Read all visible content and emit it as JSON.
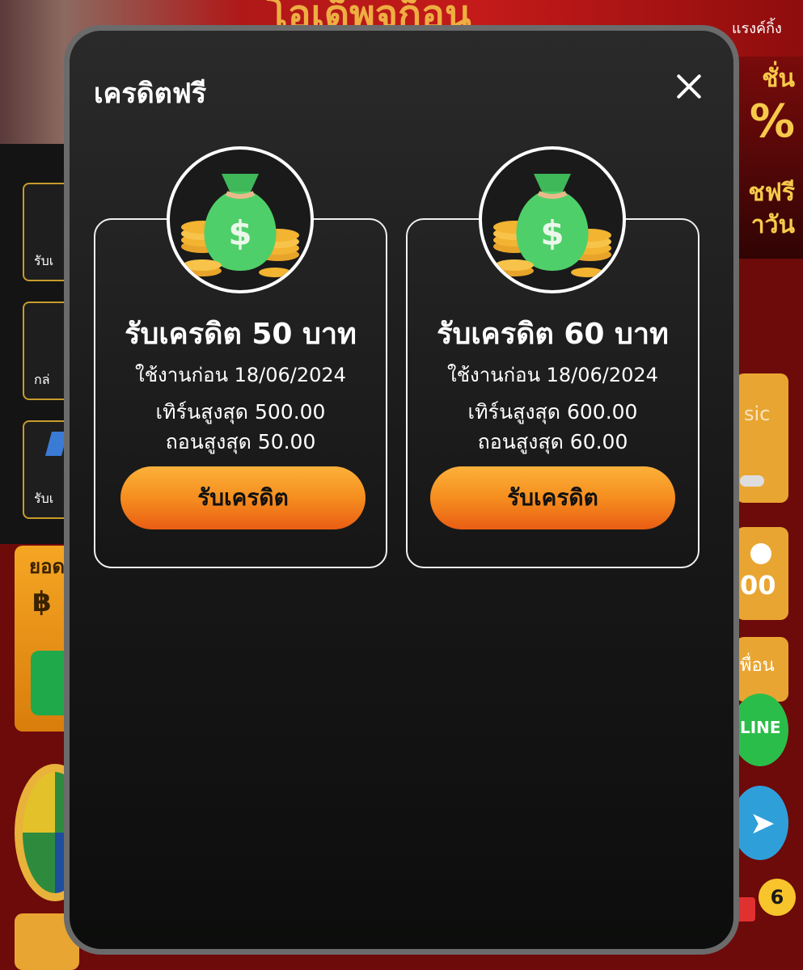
{
  "background": {
    "top_banner_text": "โอเด็พจก็อน",
    "top_right_label": "แรงค์กิ้ง",
    "promo_word_1": "ชั่น",
    "promo_percent": "%",
    "promo_word_2": "ชฟรี",
    "promo_word_3": "าวัน",
    "side_items": [
      "รับเ",
      "กล่",
      "รับเ"
    ],
    "balance_label": "ยอด",
    "balance_currency": "฿",
    "music_label": "sic",
    "balance_value": "00",
    "friend_label": "พื่อน",
    "line_label": "LINE",
    "telegram_glyph": "➤",
    "notification_count": "6"
  },
  "modal": {
    "title": "เครดิตฟรี",
    "close_glyph": "close-icon"
  },
  "cards": [
    {
      "title": "รับเครดิต 50 บาท",
      "expiry": "ใช้งานก่อน 18/06/2024",
      "turnover": "เทิร์นสูงสุด 500.00",
      "withdraw": "ถอนสูงสุด 50.00",
      "button_label": "รับเครดิต",
      "icon": "money-bag-icon"
    },
    {
      "title": "รับเครดิต 60 บาท",
      "expiry": "ใช้งานก่อน 18/06/2024",
      "turnover": "เทิร์นสูงสุด 600.00",
      "withdraw": "ถอนสูงสุด 60.00",
      "button_label": "รับเครดิต",
      "icon": "money-bag-icon"
    }
  ],
  "colors": {
    "button_top": "#fcb13a",
    "button_bottom": "#ea5d14",
    "modal_border": "#6b6b6b",
    "bag_green": "#4fcf6a",
    "coin_gold": "#f2b431"
  }
}
